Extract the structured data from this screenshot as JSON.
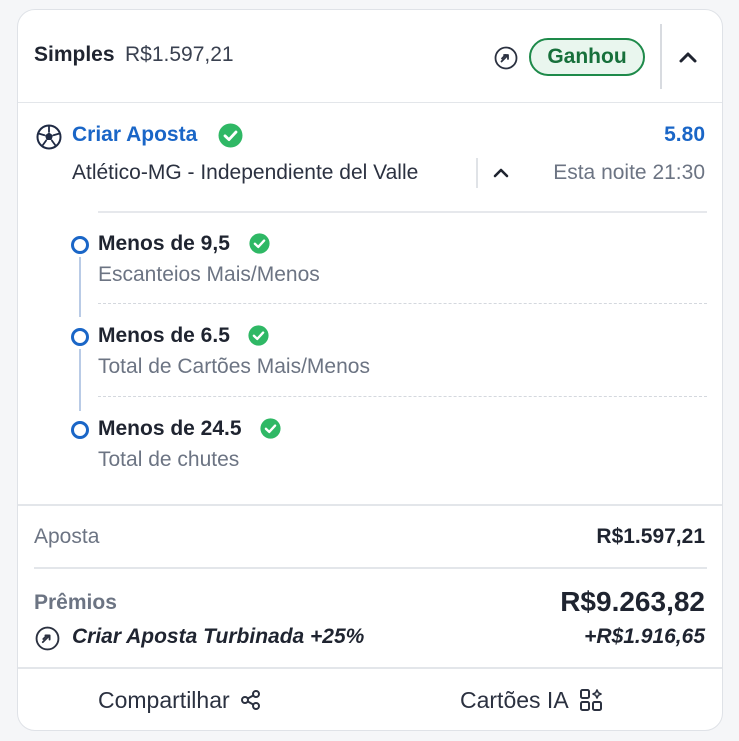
{
  "header": {
    "bet_type": "Simples",
    "stake": "R$1.597,21",
    "status": "Ganhou",
    "boost_icon": "boost-icon",
    "collapse_icon": "chevron-up-icon"
  },
  "event": {
    "sport_icon": "soccer-ball-icon",
    "title": "Criar Aposta",
    "title_check_icon": "check-circle-icon",
    "odds": "5.80",
    "match": "Atlético-MG - Independiente del Valle",
    "expand_icon": "chevron-up-icon",
    "time": "Esta noite 21:30"
  },
  "selections": [
    {
      "title": "Menos de 9,5",
      "market": "Escanteios Mais/Menos",
      "status_icon": "check-circle-icon"
    },
    {
      "title": "Menos de 6.5",
      "market": "Total de Cartões Mais/Menos",
      "status_icon": "check-circle-icon"
    },
    {
      "title": "Menos de 24.5",
      "market": "Total de chutes",
      "status_icon": "check-circle-icon"
    }
  ],
  "summary": {
    "stake_label": "Aposta",
    "stake_value": "R$1.597,21",
    "prize_label": "Prêmios",
    "prize_value": "R$9.263,82",
    "boost_label": "Criar Aposta Turbinada +25%",
    "boost_value": "+R$1.916,65"
  },
  "footer": {
    "share_label": "Compartilhar",
    "share_icon": "share-icon",
    "ai_label": "Cartões IA",
    "ai_icon": "grid-icon"
  },
  "colors": {
    "accent_blue": "#1a66c7",
    "win_green": "#1e8a4a",
    "check_green": "#2fb865",
    "muted_text": "#6c7483"
  }
}
